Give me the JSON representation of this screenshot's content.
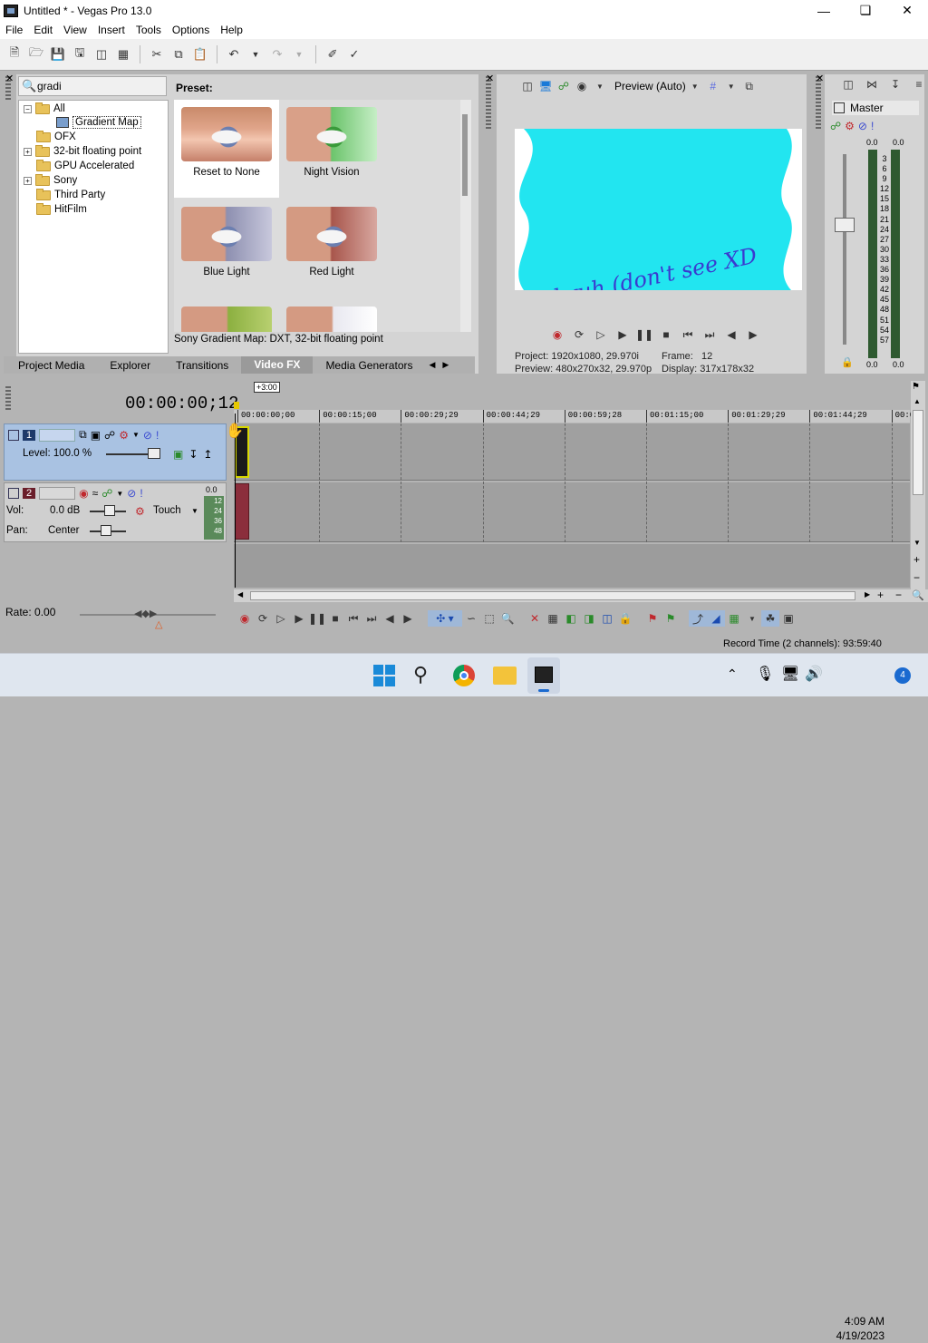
{
  "window": {
    "title": "Untitled * - Vegas Pro 13.0"
  },
  "menu": [
    "File",
    "Edit",
    "View",
    "Insert",
    "Tools",
    "Options",
    "Help"
  ],
  "toolbar_icons": [
    "new-icon",
    "open-icon",
    "save-icon",
    "save-as-icon",
    "render-icon",
    "properties-icon",
    "cut-icon",
    "copy-icon",
    "paste-icon",
    "undo-icon",
    "redo-icon",
    "trim-icon",
    "events-icon"
  ],
  "fx": {
    "search_value": "gradi",
    "preset_label": "Preset:",
    "tree": [
      {
        "label": "All",
        "expanded": true
      },
      {
        "label": "Gradient Map",
        "selected": true
      },
      {
        "label": "OFX"
      },
      {
        "label": "32-bit floating point",
        "expandable": true
      },
      {
        "label": "GPU Accelerated"
      },
      {
        "label": "Sony",
        "expandable": true
      },
      {
        "label": "Third Party"
      },
      {
        "label": "HitFilm"
      }
    ],
    "presets": [
      "Reset to None",
      "Night Vision",
      "Blue Light",
      "Red  Light"
    ],
    "status": "Sony Gradient Map: DXT, 32-bit floating point"
  },
  "tabs": [
    "Project Media",
    "Explorer",
    "Transitions",
    "Video FX",
    "Media Generators"
  ],
  "active_tab": "Video FX",
  "preview": {
    "mode": "Preview (Auto)",
    "overlay_text": "bruh (don't see XD",
    "project_label": "Project:",
    "project_value": "1920x1080, 29.970i",
    "preview_label": "Preview:",
    "preview_value": "480x270x32, 29.970p",
    "frame_label": "Frame:",
    "frame_value": "12",
    "display_label": "Display:",
    "display_value": "317x178x32"
  },
  "master": {
    "label": "Master",
    "peak_left": "0.0",
    "peak_right": "0.0",
    "scale": [
      "3",
      "6",
      "9",
      "12",
      "15",
      "18",
      "21",
      "24",
      "27",
      "30",
      "33",
      "36",
      "39",
      "42",
      "45",
      "48",
      "51",
      "54",
      "57"
    ],
    "bottom_left": "0.0",
    "bottom_right": "0.0"
  },
  "timeline": {
    "timecode": "00:00:00;12",
    "marker": "+3:00",
    "ruler": [
      "00:00:00;00",
      "00:00:15;00",
      "00:00:29;29",
      "00:00:44;29",
      "00:00:59;28",
      "00:01:15;00",
      "00:01:29;29",
      "00:01:44;29",
      "00:0"
    ],
    "track1": {
      "number": "1",
      "level": "Level: 100.0 %"
    },
    "track2": {
      "number": "2",
      "vol_label": "Vol:",
      "vol_value": "0.0 dB",
      "pan_label": "Pan:",
      "pan_value": "Center",
      "automation": "Touch",
      "meter_peak": "0.0",
      "meter_scale": [
        "12",
        "24",
        "36",
        "48"
      ]
    },
    "rate": "Rate: 0.00"
  },
  "status": {
    "record_time": "Record Time (2 channels): 93:59:40"
  },
  "taskbar": {
    "time": "4:09 AM",
    "date": "4/19/2023",
    "notifications": "4"
  }
}
